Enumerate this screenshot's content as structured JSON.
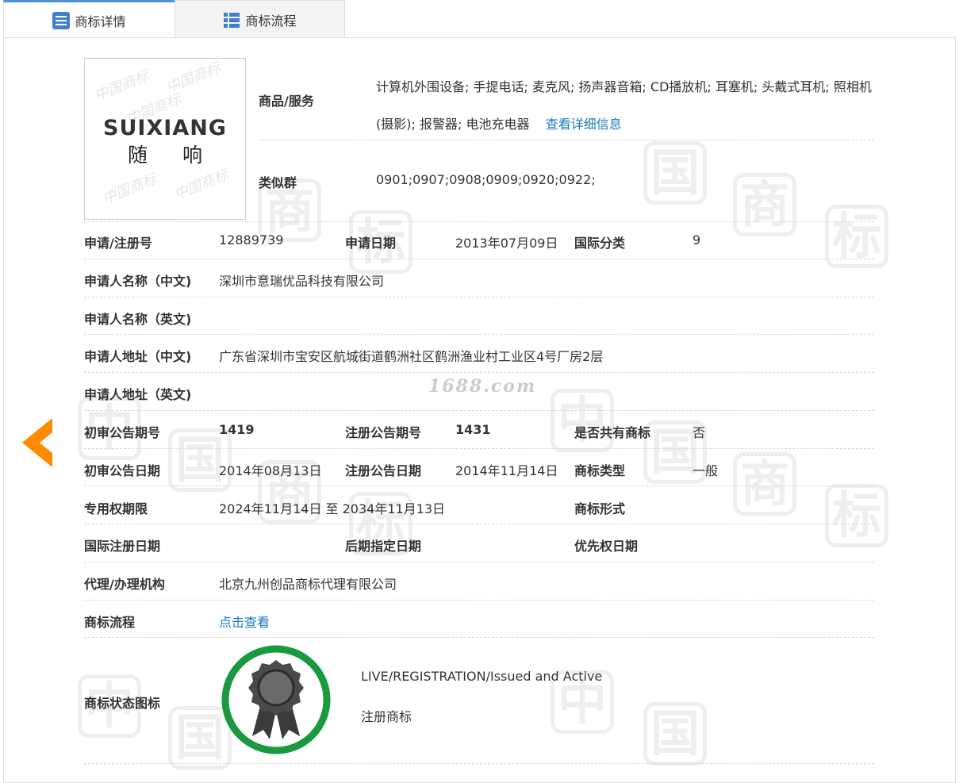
{
  "tabs": [
    {
      "label": "商标详情",
      "icon": "list-icon",
      "active": true
    },
    {
      "label": "商标流程",
      "icon": "grid-list-icon",
      "active": false
    }
  ],
  "logo": {
    "text_en": "SUIXIANG",
    "text_cn": "随 响",
    "watermark": "中国商标"
  },
  "goods": {
    "label": "商品/服务",
    "value": "计算机外围设备; 手提电话; 麦克风; 扬声器音箱; CD播放机; 耳塞机; 头戴式耳机; 照相机(摄影); 报警器; 电池充电器",
    "link": "查看详细信息"
  },
  "similar": {
    "label": "类似群",
    "value": "0901;0907;0908;0909;0920;0922;"
  },
  "reg_no": {
    "label": "申请/注册号",
    "value": "12889739"
  },
  "app_date": {
    "label": "申请日期",
    "value": "2013年07月09日"
  },
  "intl_class": {
    "label": "国际分类",
    "value": "9"
  },
  "applicant_cn": {
    "label": "申请人名称（中文)",
    "value": "深圳市意瑞优品科技有限公司"
  },
  "applicant_en": {
    "label": "申请人名称（英文)",
    "value": ""
  },
  "address_cn": {
    "label": "申请人地址（中文)",
    "value": "广东省深圳市宝安区航城街道鹤洲社区鹤洲渔业村工业区4号厂房2层"
  },
  "address_en": {
    "label": "申请人地址（英文)",
    "value": ""
  },
  "prelim_no": {
    "label": "初审公告期号",
    "value": "1419"
  },
  "reg_pub_no": {
    "label": "注册公告期号",
    "value": "1431"
  },
  "shared": {
    "label": "是否共有商标",
    "value": "否"
  },
  "prelim_date": {
    "label": "初审公告日期",
    "value": "2014年08月13日"
  },
  "reg_pub_date": {
    "label": "注册公告日期",
    "value": "2014年11月14日"
  },
  "tm_type": {
    "label": "商标类型",
    "value": "一般"
  },
  "exclusive": {
    "label": "专用权期限",
    "value": "2024年11月14日 至 2034年11月13日"
  },
  "tm_form": {
    "label": "商标形式",
    "value": ""
  },
  "intl_reg_date": {
    "label": "国际注册日期",
    "value": ""
  },
  "later_date": {
    "label": "后期指定日期",
    "value": ""
  },
  "priority_date": {
    "label": "优先权日期",
    "value": ""
  },
  "agent": {
    "label": "代理/办理机构",
    "value": "北京九州创品商标代理有限公司"
  },
  "flow": {
    "label": "商标流程",
    "link": "点击查看"
  },
  "status": {
    "label": "商标状态图标",
    "en": "LIVE/REGISTRATION/Issued and Active",
    "cn": "注册商标",
    "ring_color": "#1a9a40"
  },
  "site_watermark": "1688.com",
  "colors": {
    "accent": "#4a90d9",
    "link": "#1b7bbd",
    "arrow": "#ff8a00"
  }
}
